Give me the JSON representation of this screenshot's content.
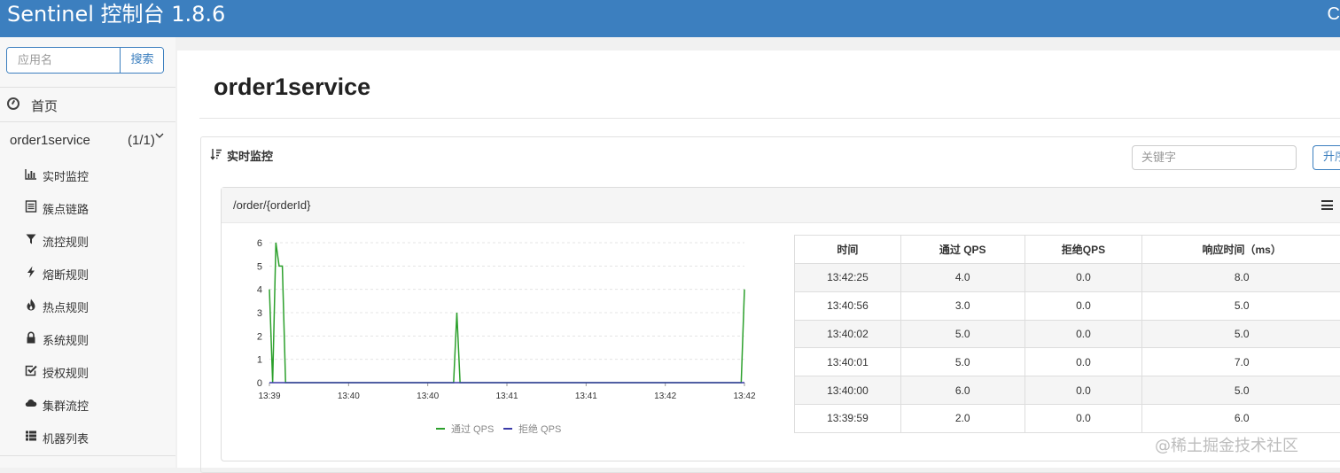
{
  "topbar": {
    "brand": "Sentinel 控制台 1.8.6",
    "corner": "C"
  },
  "sidebar": {
    "search": {
      "placeholder": "应用名",
      "button": "搜索"
    },
    "home": "首页",
    "app": {
      "name": "order1service",
      "count": "(1/1)"
    },
    "menu": [
      {
        "label": "实时监控",
        "icon": "bar-chart-icon"
      },
      {
        "label": "簇点链路",
        "icon": "list-icon"
      },
      {
        "label": "流控规则",
        "icon": "filter-icon"
      },
      {
        "label": "熔断规则",
        "icon": "flash-icon"
      },
      {
        "label": "热点规则",
        "icon": "fire-icon"
      },
      {
        "label": "系统规则",
        "icon": "lock-icon"
      },
      {
        "label": "授权规则",
        "icon": "check-icon"
      },
      {
        "label": "集群流控",
        "icon": "cloud-icon"
      },
      {
        "label": "机器列表",
        "icon": "grid-list-icon"
      }
    ]
  },
  "main": {
    "title": "order1service",
    "panel": {
      "title": "实时监控",
      "keyword_placeholder": "关键字",
      "sort_button": "升序"
    },
    "resource": {
      "name": "/order/{orderId}",
      "table": {
        "headers": [
          "时间",
          "通过 QPS",
          "拒绝QPS",
          "响应时间（ms）"
        ],
        "rows": [
          [
            "13:42:25",
            "4.0",
            "0.0",
            "8.0"
          ],
          [
            "13:40:56",
            "3.0",
            "0.0",
            "5.0"
          ],
          [
            "13:40:02",
            "5.0",
            "0.0",
            "5.0"
          ],
          [
            "13:40:01",
            "5.0",
            "0.0",
            "7.0"
          ],
          [
            "13:40:00",
            "6.0",
            "0.0",
            "5.0"
          ],
          [
            "13:39:59",
            "2.0",
            "0.0",
            "6.0"
          ]
        ]
      }
    }
  },
  "chart_data": {
    "type": "line",
    "x_ticks": [
      "13:39",
      "13:40",
      "13:40",
      "13:41",
      "13:41",
      "13:42",
      "13:42"
    ],
    "y_ticks": [
      0,
      1,
      2,
      3,
      4,
      5,
      6
    ],
    "ylim": [
      0,
      6
    ],
    "xlim_seconds": [
      "13:39:59",
      "13:42:25"
    ],
    "series": [
      {
        "name": "通过 QPS",
        "color": "#2ca02c",
        "points": [
          [
            "13:39:58",
            4
          ],
          [
            "13:39:59",
            0
          ],
          [
            "13:40:00",
            6
          ],
          [
            "13:40:01",
            5
          ],
          [
            "13:40:02",
            5
          ],
          [
            "13:40:03",
            0
          ],
          [
            "13:40:55",
            0
          ],
          [
            "13:40:56",
            3
          ],
          [
            "13:40:57",
            0
          ],
          [
            "13:42:24",
            0
          ],
          [
            "13:42:25",
            4
          ]
        ]
      },
      {
        "name": "拒绝 QPS",
        "color": "#3a3aa8",
        "points": [
          [
            "13:39:58",
            0
          ],
          [
            "13:42:25",
            0
          ]
        ]
      }
    ],
    "grid": "horizontal-dashed",
    "legend": "bottom-center"
  },
  "watermark": "@稀土掘金技术社区"
}
